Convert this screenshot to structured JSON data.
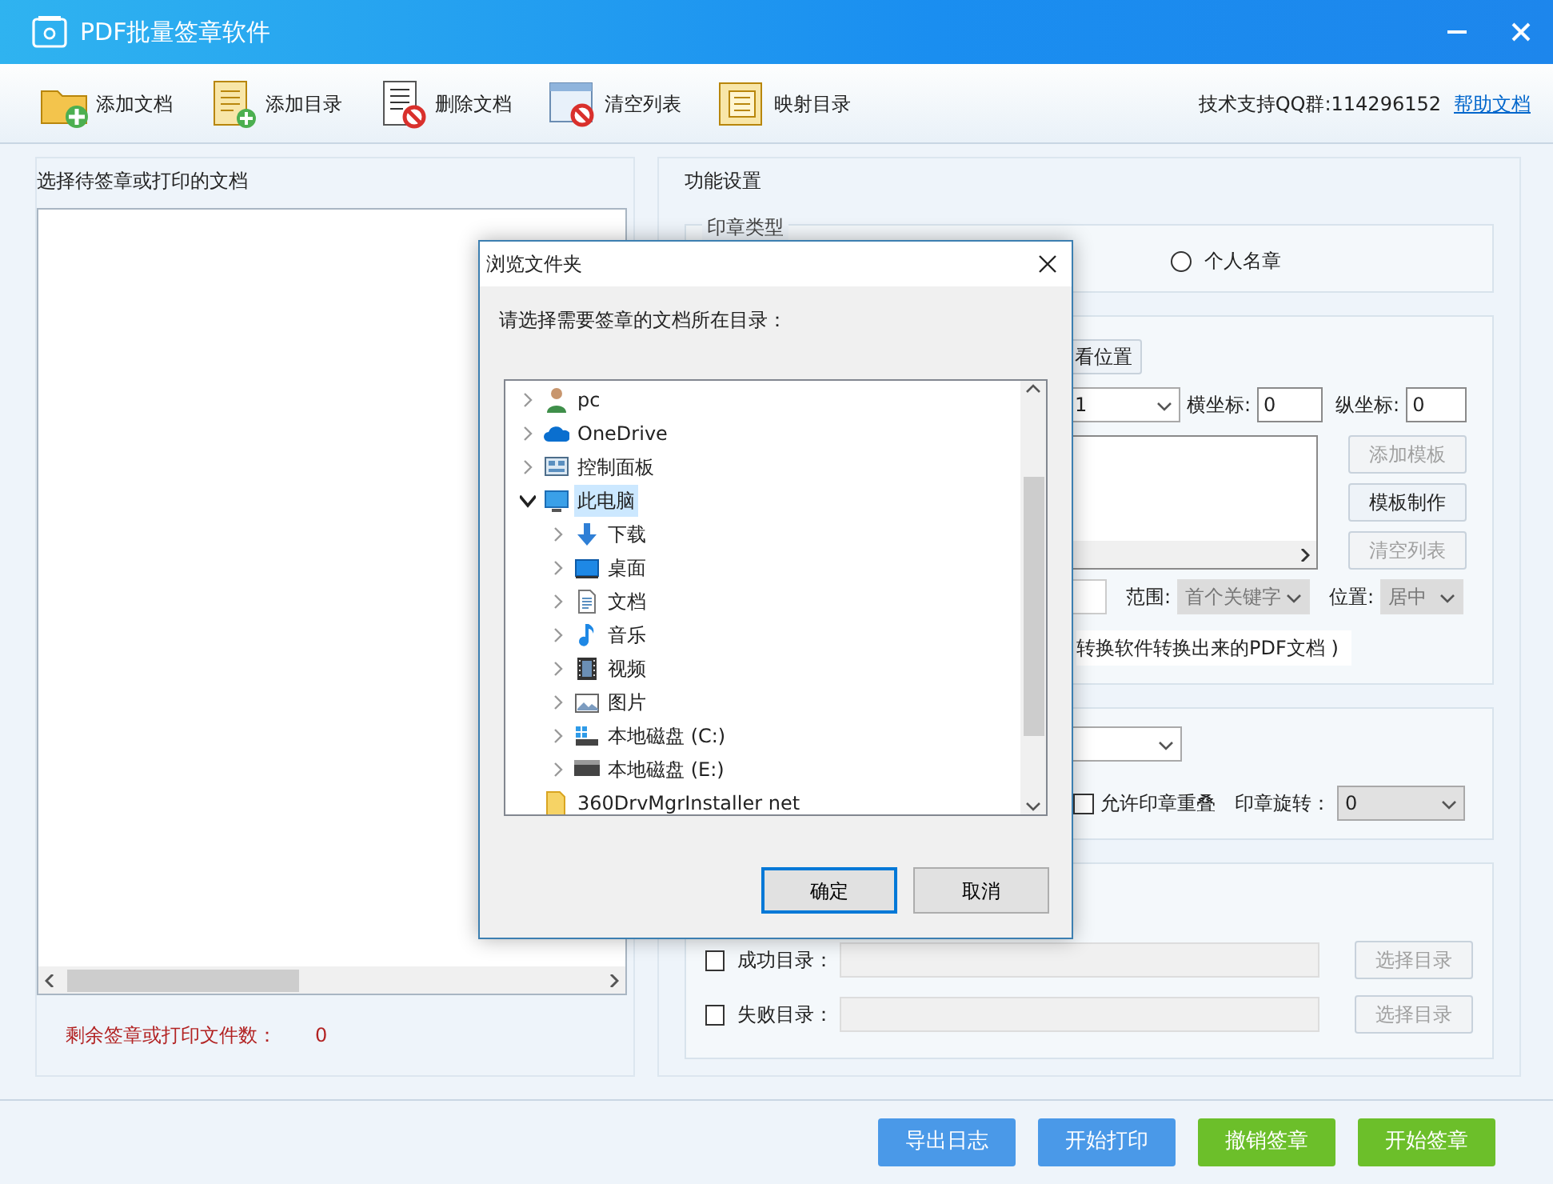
{
  "window": {
    "title": "PDF批量签章软件"
  },
  "toolbar": {
    "buttons": [
      {
        "label": "添加文档",
        "kind": "add-file"
      },
      {
        "label": "添加目录",
        "kind": "add-list"
      },
      {
        "label": "删除文档",
        "kind": "delete"
      },
      {
        "label": "清空列表",
        "kind": "clear"
      },
      {
        "label": "映射目录",
        "kind": "map"
      }
    ],
    "support_text": "技术支持QQ群:114296152",
    "help_link": "帮助文档"
  },
  "left_panel": {
    "heading": "选择待签章或打印的文档",
    "remaining_label": "剩余签章或打印文件数：",
    "remaining_count": "0"
  },
  "right_panel": {
    "heading": "功能设置",
    "stamp_type": {
      "legend": "印章类型",
      "options": [
        {
          "label": "个人名章",
          "selected": false
        }
      ]
    },
    "position": {
      "view_button": "看位置",
      "page_select": "1",
      "x_label": "横坐标:",
      "x_value": "0",
      "y_label": "纵坐标:",
      "y_value": "0",
      "template_buttons": [
        {
          "label": "添加模板",
          "disabled": true
        },
        {
          "label": "模板制作",
          "disabled": false
        },
        {
          "label": "清空列表",
          "disabled": true
        }
      ],
      "range_label": "范围:",
      "range_select": {
        "value": "首个关键字",
        "disabled": true
      },
      "place_label": "位置:",
      "place_select": {
        "value": "居中",
        "disabled": true
      },
      "note": "转换软件转换出来的PDF文档 )"
    },
    "options": {
      "overlap": {
        "label": "允许印章重叠",
        "checked": false
      },
      "rotation_label": "印章旋转：",
      "rotation_value": "0"
    },
    "output": {
      "rows": [
        {
          "label": "成功目录：",
          "checked": false,
          "button": {
            "label": "选择目录",
            "disabled": true
          }
        },
        {
          "label": "失败目录：",
          "checked": false,
          "button": {
            "label": "选择目录",
            "disabled": true
          }
        }
      ]
    }
  },
  "footer_buttons": [
    {
      "label": "导出日志",
      "kind": "primary"
    },
    {
      "label": "开始打印",
      "kind": "primary"
    },
    {
      "label": "撤销签章",
      "kind": "success"
    },
    {
      "label": "开始签章",
      "kind": "success"
    }
  ],
  "dialog": {
    "title": "浏览文件夹",
    "prompt": "请选择需要签章的文档所在目录：",
    "tree": [
      {
        "label": "pc",
        "kind": "user",
        "expanded": false,
        "selected": false
      },
      {
        "label": "OneDrive",
        "kind": "cloud",
        "expanded": false,
        "selected": false
      },
      {
        "label": "控制面板",
        "kind": "control-panel",
        "expanded": false,
        "selected": false
      },
      {
        "label": "此电脑",
        "kind": "computer",
        "expanded": true,
        "selected": true,
        "children": [
          {
            "label": "下载",
            "kind": "download",
            "expanded": false,
            "selected": false
          },
          {
            "label": "桌面",
            "kind": "desktop",
            "expanded": false,
            "selected": false
          },
          {
            "label": "文档",
            "kind": "document",
            "expanded": false,
            "selected": false
          },
          {
            "label": "音乐",
            "kind": "music",
            "expanded": false,
            "selected": false
          },
          {
            "label": "视频",
            "kind": "video",
            "expanded": false,
            "selected": false
          },
          {
            "label": "图片",
            "kind": "picture-folder",
            "expanded": false,
            "selected": false
          },
          {
            "label": "本地磁盘 (C:)",
            "kind": "system-drive",
            "expanded": false,
            "selected": false
          },
          {
            "label": "本地磁盘 (E:)",
            "kind": "drive",
            "expanded": false,
            "selected": false
          }
        ]
      },
      {
        "label": "360DrvMgrInstaller net",
        "kind": "folder",
        "selected": false
      }
    ],
    "buttons": [
      {
        "label": "确定",
        "focused": true
      },
      {
        "label": "取消",
        "focused": false
      }
    ]
  }
}
